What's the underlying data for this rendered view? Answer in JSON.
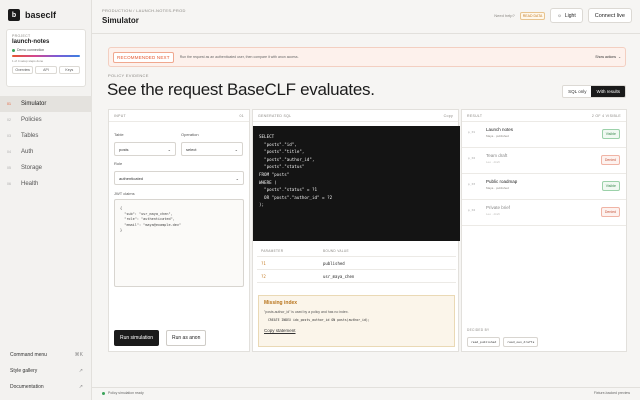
{
  "brand": {
    "name": "baseclf",
    "logo": "b"
  },
  "project": {
    "label": "PROJECT",
    "name": "launch-notes",
    "connection": "Demo connection",
    "meta": "1 of 4 setup steps done",
    "tabs": [
      "Overview",
      "API",
      "Keys"
    ]
  },
  "nav": [
    {
      "num": "01",
      "label": "Simulator",
      "active": true
    },
    {
      "num": "02",
      "label": "Policies"
    },
    {
      "num": "03",
      "label": "Tables"
    },
    {
      "num": "04",
      "label": "Auth"
    },
    {
      "num": "05",
      "label": "Storage"
    },
    {
      "num": "06",
      "label": "Health"
    }
  ],
  "side_bottom": [
    {
      "label": "Command menu",
      "icon": "⌘K"
    },
    {
      "label": "Style gallery",
      "icon": "↗"
    },
    {
      "label": "Documentation",
      "icon": "↗"
    }
  ],
  "header": {
    "breadcrumb": "PRODUCTION / LAUNCH-NOTES-PROD",
    "title": "Simulator",
    "need_help": "Need help?",
    "docs_badge": "READ DATA",
    "light_label": "Light",
    "light_icon": "☼",
    "connect_label": "Connect live"
  },
  "banner": {
    "badge": "RECOMMENDED NEXT",
    "text": "Run the request as an authenticated user, then compare it with anon access.",
    "action": "Show actions",
    "action_icon": "⌄"
  },
  "section": {
    "eyebrow": "POLICY EVIDENCE",
    "title": "See the request BaseCLF evaluates.",
    "toggle": [
      "SQL only",
      "With results"
    ]
  },
  "input_panel": {
    "head": "INPUT",
    "head_num": "01",
    "table_label": "Table",
    "table_value": "posts",
    "operation_label": "Operation",
    "operation_value": "select",
    "role_label": "Role",
    "role_value": "authenticated",
    "jwt_label": "JWT claims",
    "jwt_text": "{\n  \"sub\": \"usr_maya_chen\",\n  \"role\": \"authenticated\",\n  \"email\": \"maya@example.dev\"\n}",
    "run_label": "Run simulation",
    "anon_label": "Run as anon"
  },
  "sql_panel": {
    "head": "GENERATED SQL",
    "copy": "Copy",
    "sql": "SELECT\n  \"posts\".\"id\",\n  \"posts\".\"title\",\n  \"posts\".\"author_id\",\n  \"posts\".\"status\"\nFROM \"posts\"\nWHERE (\n  \"posts\".\"status\" = ?1\n  OR \"posts\".\"author_id\" = ?2\n);",
    "param_header": [
      "PARAMETER",
      "BOUND VALUE"
    ],
    "params": [
      {
        "name": "?1",
        "value": "published"
      },
      {
        "name": "?2",
        "value": "usr_maya_chen"
      }
    ],
    "missing_title": "Missing index",
    "missing_text": "\"posts.author_id\" is used by a policy and has no index.",
    "missing_code": "CREATE INDEX idx_posts_author_id ON posts(author_id);",
    "copy_statement": "Copy statement"
  },
  "result_panel": {
    "head": "RESULT",
    "count": "2 OF 4 VISIBLE",
    "rows": [
      {
        "id": "p_01",
        "title": "Launch notes",
        "sub": "Maya · published",
        "status": "Visible"
      },
      {
        "id": "p_02",
        "title": "Team draft",
        "sub": "Leo · draft",
        "status": "Denied"
      },
      {
        "id": "p_03",
        "title": "Public roadmap",
        "sub": "Maya · published",
        "status": "Visible"
      },
      {
        "id": "p_04",
        "title": "Private brief",
        "sub": "Leo · draft",
        "status": "Denied"
      }
    ],
    "decided_label": "DECIDED BY",
    "chips": [
      "read_published",
      "read_own_drafts"
    ]
  },
  "status": {
    "left": "Policy simulation ready",
    "right": "Fixture-backed preview"
  }
}
